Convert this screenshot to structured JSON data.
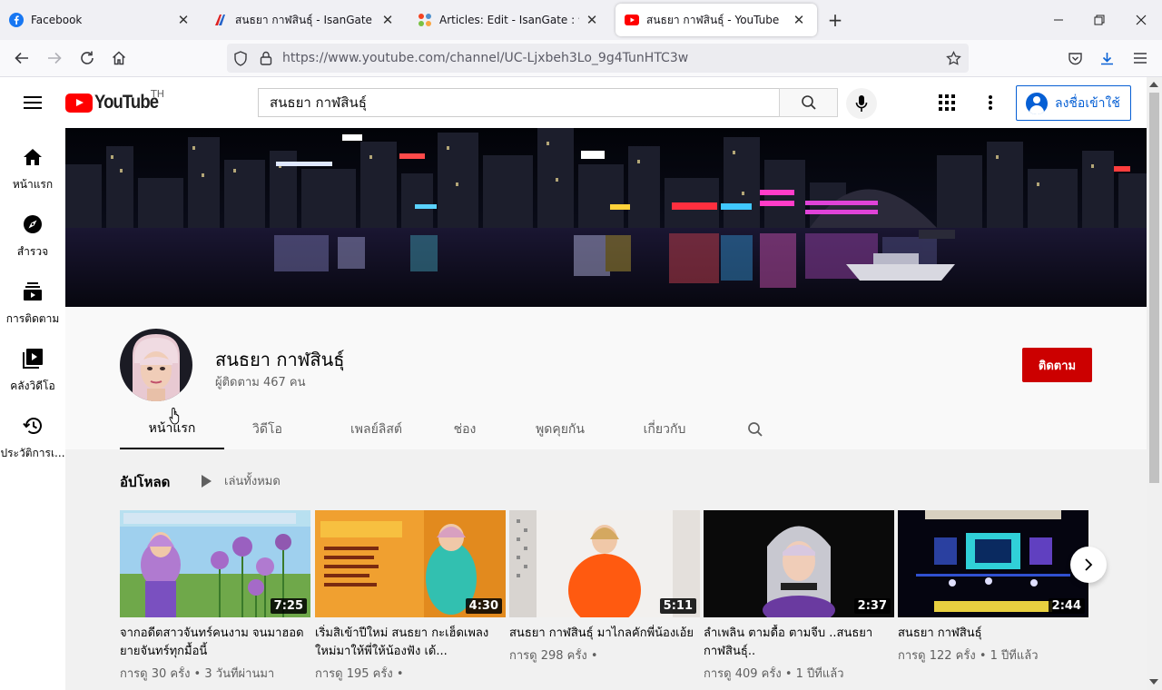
{
  "browser": {
    "tabs": [
      {
        "label": "Facebook",
        "active": false
      },
      {
        "label": "สนธยา กาฬสินธุ์ - IsanGate : ประ",
        "active": false
      },
      {
        "label": "Articles: Edit - IsanGate : ประตูสู่",
        "active": false
      },
      {
        "label": "สนธยา กาฬสินธุ์ - YouTube",
        "active": true
      }
    ],
    "url": "https://www.youtube.com/channel/UC-Ljxbeh3Lo_9g4TunHTC3w"
  },
  "header": {
    "logo_text": "YouTube",
    "region": "TH",
    "search_value": "สนธยา กาฬสินธุ์",
    "signin_label": "ลงชื่อเข้าใช้"
  },
  "guide": {
    "items": [
      {
        "label": "หน้าแรก",
        "icon": "home-icon"
      },
      {
        "label": "สำรวจ",
        "icon": "explore-icon"
      },
      {
        "label": "การติดตาม",
        "icon": "subscriptions-icon"
      },
      {
        "label": "คลังวิดีโอ",
        "icon": "library-icon"
      },
      {
        "label": "ประวัติการเ...",
        "icon": "history-icon"
      }
    ]
  },
  "channel": {
    "name": "สนธยา กาฬสินธุ์",
    "subscribers": "ผู้ติดตาม 467 คน",
    "subscribe_label": "ติดตาม",
    "tabs": [
      {
        "label": "หน้าแรก",
        "selected": true
      },
      {
        "label": "วิดีโอ",
        "selected": false
      },
      {
        "label": "เพลย์ลิสต์",
        "selected": false
      },
      {
        "label": "ช่อง",
        "selected": false
      },
      {
        "label": "พูดคุยกัน",
        "selected": false
      },
      {
        "label": "เกี่ยวกับ",
        "selected": false
      }
    ]
  },
  "shelf": {
    "title": "อัปโหลด",
    "play_all": "เล่นทั้งหมด",
    "videos": [
      {
        "title": "จากอดีตสาวจันทร์คนงาม จนมาฮอดยายจันทร์ทุกมื้อนี้",
        "duration": "7:25",
        "meta": "การดู 30 ครั้ง • 3 วันที่ผ่านมา"
      },
      {
        "title": "เริ่มสิเข้าปีใหม่ สนธยา กะเฮ็ดเพลงใหม่มาให้พี่ให้น้องฟัง เด้...",
        "duration": "4:30",
        "meta": "การดู 195 ครั้ง •"
      },
      {
        "title": "สนธยา กาฬสินธุ์ มาไกลคักพี่น้องเอ้ย",
        "duration": "5:11",
        "meta": "การดู 298 ครั้ง •"
      },
      {
        "title": "ลำเพลิน ตามดื้อ ตามจีบ ..สนธยา กาฬสินธุ์..",
        "duration": "2:37",
        "meta": "การดู 409 ครั้ง • 1 ปีที่แล้ว"
      },
      {
        "title": "สนธยา กาฬสินธุ์",
        "duration": "2:44",
        "meta": "การดู 122 ครั้ง • 1 ปีที่แล้ว"
      }
    ]
  },
  "colors": {
    "accent_blue": "#065fd4",
    "subscribe_red": "#cc0000",
    "logo_red": "#ff0000"
  }
}
